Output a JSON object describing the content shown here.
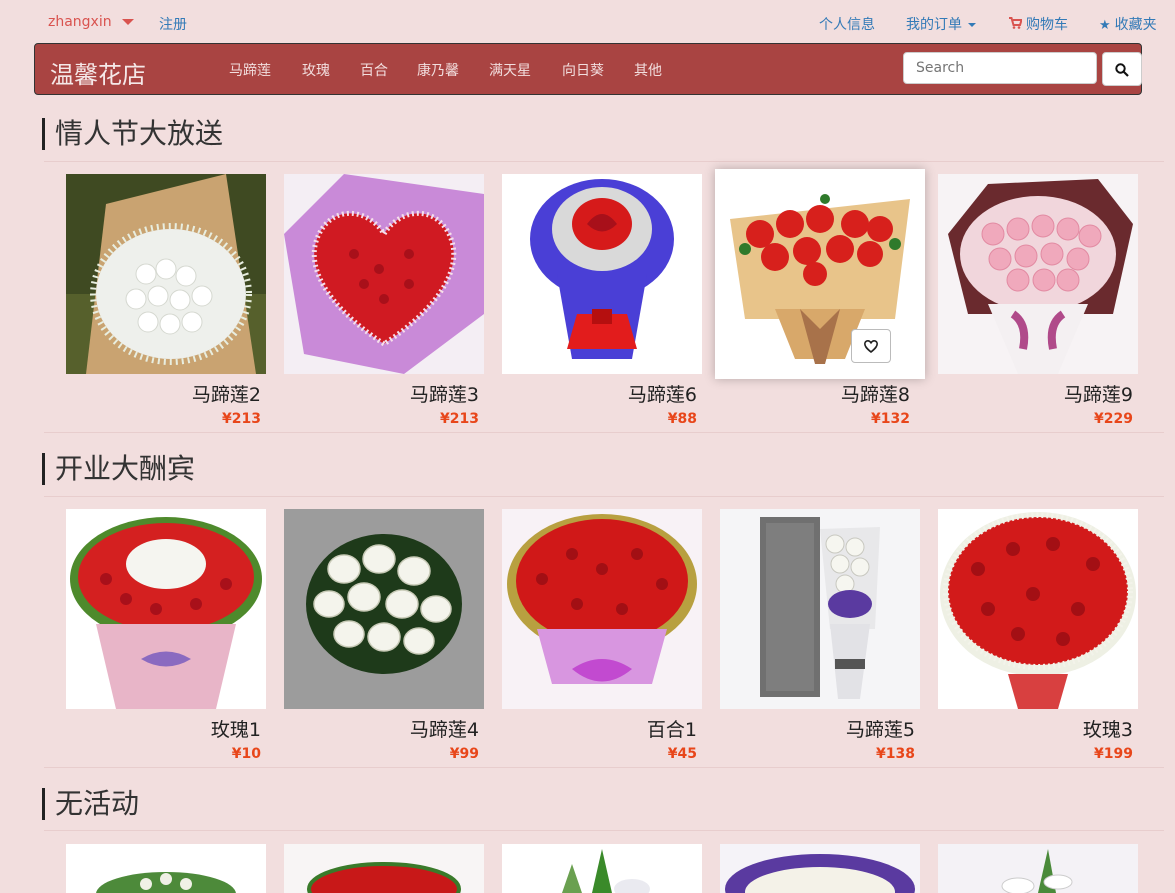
{
  "topbar": {
    "username": "zhangxin",
    "register": "注册",
    "profile": "个人信息",
    "orders": "我的订单",
    "cart": "购物车",
    "favorites": "收藏夹"
  },
  "navbar": {
    "brand": "温馨花店",
    "items": [
      "马蹄莲",
      "玫瑰",
      "百合",
      "康乃馨",
      "满天星",
      "向日葵",
      "其他"
    ],
    "search_placeholder": "Search"
  },
  "sections": [
    {
      "title": "情人节大放送",
      "products": [
        {
          "name": "马蹄莲2",
          "price": "¥213"
        },
        {
          "name": "马蹄莲3",
          "price": "¥213"
        },
        {
          "name": "马蹄莲6",
          "price": "¥88"
        },
        {
          "name": "马蹄莲8",
          "price": "¥132"
        },
        {
          "name": "马蹄莲9",
          "price": "¥229"
        }
      ]
    },
    {
      "title": "开业大酬宾",
      "products": [
        {
          "name": "玫瑰1",
          "price": "¥10"
        },
        {
          "name": "马蹄莲4",
          "price": "¥99"
        },
        {
          "name": "百合1",
          "price": "¥45"
        },
        {
          "name": "马蹄莲5",
          "price": "¥138"
        },
        {
          "name": "玫瑰3",
          "price": "¥199"
        }
      ]
    },
    {
      "title": "无活动",
      "products": [
        {},
        {},
        {},
        {},
        {}
      ]
    }
  ],
  "colors": {
    "page_bg": "#f2dede",
    "navbar_bg": "#a94442",
    "price": "#e8461a",
    "link": "#337ab7",
    "user": "#d9534f"
  }
}
